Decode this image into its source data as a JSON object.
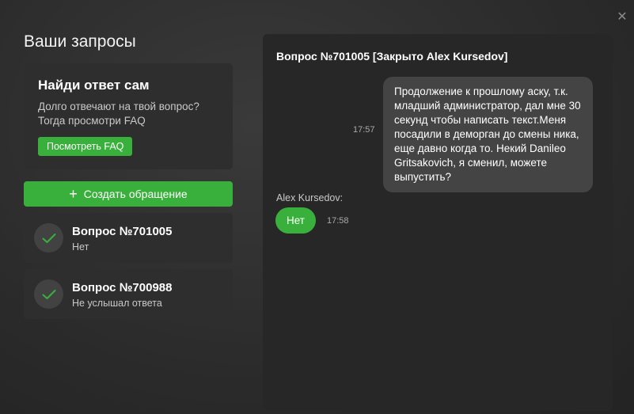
{
  "page": {
    "title": "Ваши запросы",
    "close_icon": "close-icon"
  },
  "faq": {
    "title": "Найди ответ сам",
    "text_line1": "Долго отвечают на твой вопрос?",
    "text_line2": "Тогда просмотри FAQ",
    "button_label": "Посмотреть FAQ"
  },
  "create": {
    "icon": "plus-icon",
    "label": "Создать обращение"
  },
  "tickets": [
    {
      "title": "Вопрос №701005",
      "subtitle": "Нет",
      "status_icon": "check-icon"
    },
    {
      "title": "Вопрос №700988",
      "subtitle": "Не услышал ответа",
      "status_icon": "check-icon"
    }
  ],
  "chat": {
    "title": "Вопрос №701005 [Закрыто Alex Kursedov]",
    "messages": [
      {
        "direction": "outgoing",
        "text": "Продолжение к прошлому аску, т.к. младший администратор, дал мне 30 секунд чтобы написать текст.Меня посадили в деморган до смены ника, еще давно когда то. Некий Danileo Gritsakovich, я сменил, можете выпустить?",
        "time": "17:57"
      },
      {
        "direction": "incoming",
        "author": "Alex Kursedov:",
        "text": "Нет",
        "time": "17:58"
      }
    ]
  },
  "colors": {
    "accent": "#3ab03c",
    "card_bg": "#2e2e2e",
    "panel_bg": "#272727",
    "bubble_out": "#444444"
  }
}
